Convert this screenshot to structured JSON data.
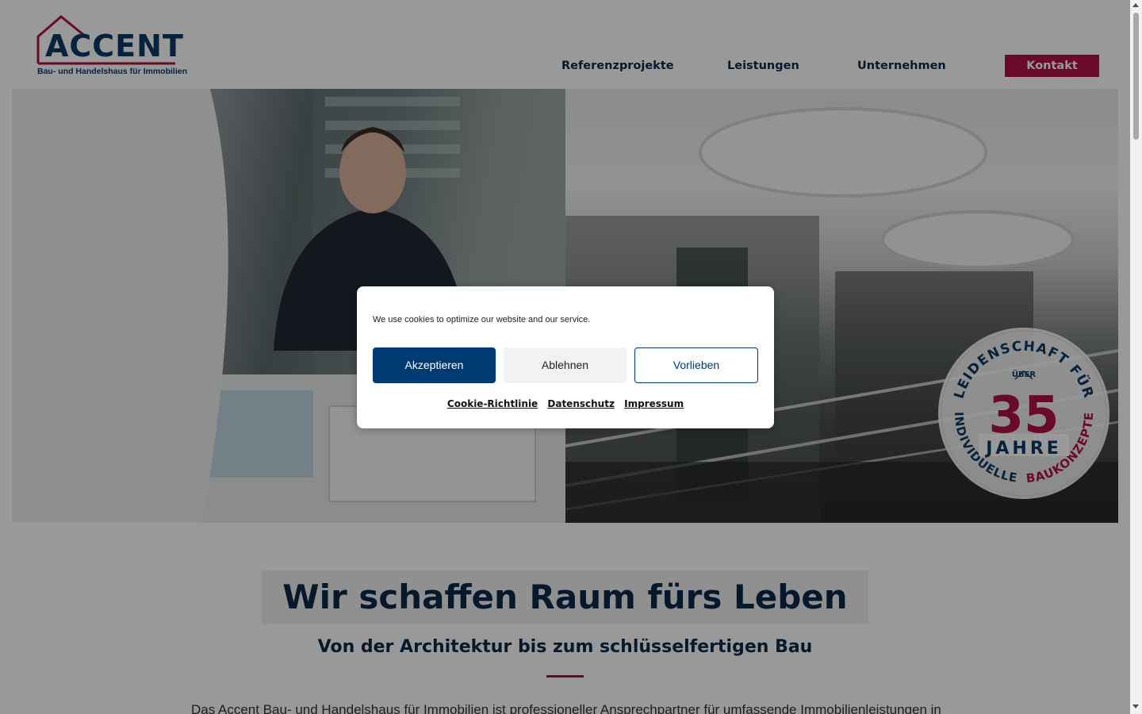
{
  "logo": {
    "name": "ACCENT",
    "tagline": "Bau- und Handelshaus für Immobilien"
  },
  "nav": {
    "items": [
      "Referenzprojekte",
      "Leistungen",
      "Unternehmen"
    ],
    "cta": "Kontakt"
  },
  "badge": {
    "top_arc": "LEIDENSCHAFT FÜR",
    "small": "ÜBER",
    "number": "35",
    "unit": "JAHRE",
    "bottom_arc_a": "INDIVIDUELLE",
    "bottom_arc_b": "BAUKONZEPTE"
  },
  "cookie": {
    "text": "We use cookies to optimize our website and our service.",
    "accept": "Akzeptieren",
    "deny": "Ablehnen",
    "preferences": "Vorlieben",
    "links": [
      "Cookie-Richtlinie",
      "Datenschutz",
      "Impressum"
    ]
  },
  "content": {
    "headline": "Wir schaffen Raum fürs Leben",
    "subhead": "Von der Architektur bis zum schlüsselfertigen Bau",
    "body": "Das Accent Bau- und Handelshaus für Immobilien ist professioneller Ansprechpartner für umfassende Immobilienleistungen in"
  },
  "colors": {
    "brand_blue": "#0b3a66",
    "brand_red": "#b01245",
    "accept_button": "#003a73"
  }
}
